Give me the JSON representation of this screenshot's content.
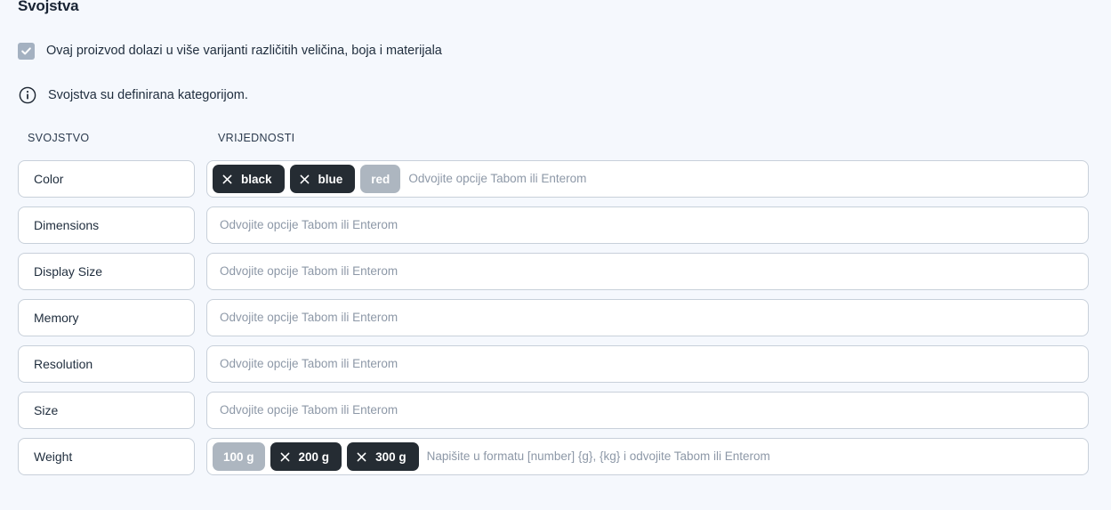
{
  "section": {
    "title": "Svojstva"
  },
  "variant_checkbox": {
    "label": "Ovaj proizvod dolazi u više varijanti različitih veličina, boja i materijala",
    "checked": true,
    "disabled": true,
    "icon": "check-icon",
    "fill_color": "#a4b1c1"
  },
  "info_notice": {
    "icon": "info-circle-icon",
    "text": "Svojstva su definirana kategorijom."
  },
  "table": {
    "headers": {
      "property": "SVOJSTVO",
      "values": "VRIJEDNOSTI"
    },
    "placeholders": {
      "default": "Odvojite opcije Tabom ili Enterom",
      "weight": "Napišite u formatu [number] {g}, {kg} i odvojite Tabom ili Enterom"
    },
    "rows": [
      {
        "property": "Color",
        "placeholder": "Odvojite opcije Tabom ili Enterom",
        "chips": [
          {
            "label": "black",
            "removable": true,
            "remove_icon": "close-icon"
          },
          {
            "label": "blue",
            "removable": true,
            "remove_icon": "close-icon"
          },
          {
            "label": "red",
            "removable": false
          }
        ]
      },
      {
        "property": "Dimensions",
        "placeholder": "Odvojite opcije Tabom ili Enterom",
        "chips": []
      },
      {
        "property": "Display Size",
        "placeholder": "Odvojite opcije Tabom ili Enterom",
        "chips": []
      },
      {
        "property": "Memory",
        "placeholder": "Odvojite opcije Tabom ili Enterom",
        "chips": []
      },
      {
        "property": "Resolution",
        "placeholder": "Odvojite opcije Tabom ili Enterom",
        "chips": []
      },
      {
        "property": "Size",
        "placeholder": "Odvojite opcije Tabom ili Enterom",
        "chips": []
      },
      {
        "property": "Weight",
        "placeholder": "Napišite u formatu [number] {g}, {kg} i odvojite Tabom ili Enterom",
        "chips": [
          {
            "label": "100 g",
            "removable": false
          },
          {
            "label": "200 g",
            "removable": true,
            "remove_icon": "close-icon"
          },
          {
            "label": "300 g",
            "removable": true,
            "remove_icon": "close-icon"
          }
        ]
      }
    ]
  },
  "colors": {
    "background": "#f5f8fd",
    "chip_dark": "#252c33",
    "chip_muted": "#adb6c0",
    "border": "#c8d0da",
    "text": "#1f2d3d",
    "placeholder": "#8d98a7"
  }
}
